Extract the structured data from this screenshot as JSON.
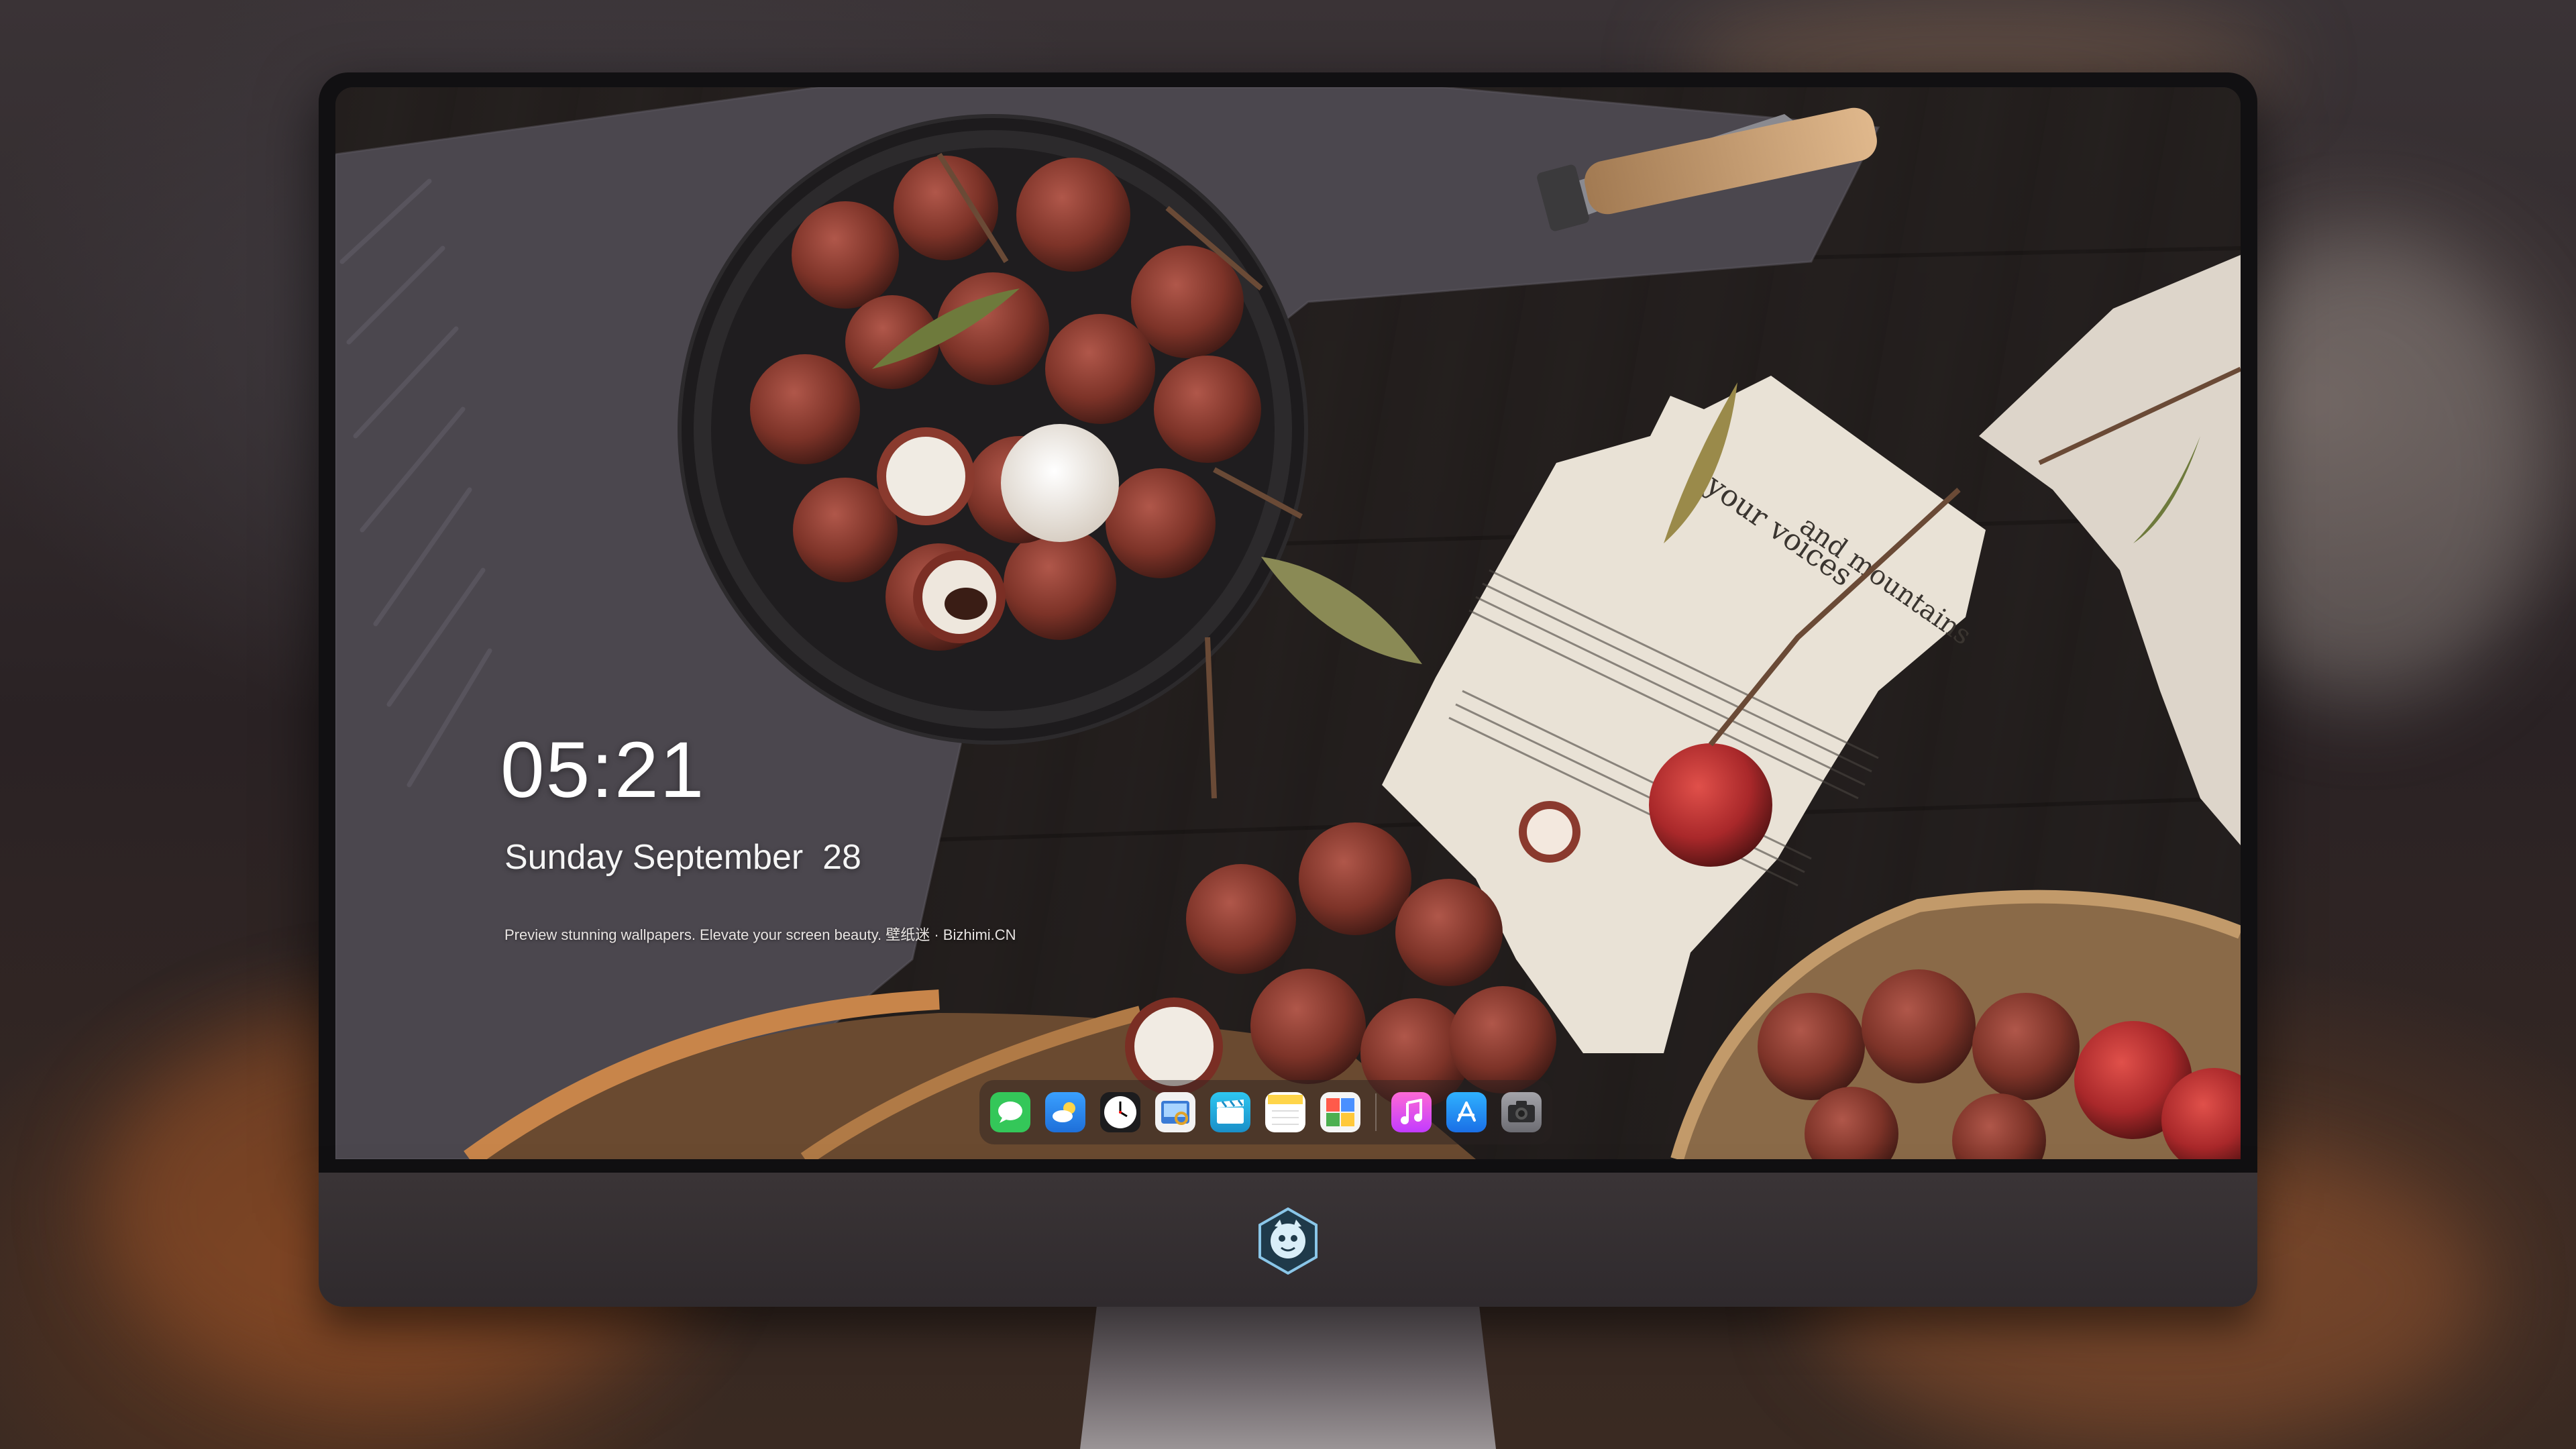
{
  "lockscreen": {
    "time": "05:21",
    "date": "Sunday September  28",
    "tagline": "Preview stunning wallpapers. Elevate your screen beauty. 壁纸迷 · Bizhimi.CN"
  },
  "dock": {
    "apps": [
      {
        "icon": "messages-icon",
        "color": "#34c759"
      },
      {
        "icon": "weather-icon",
        "color": "#1e90ff"
      },
      {
        "icon": "clock-icon",
        "color": "#ffffff"
      },
      {
        "icon": "preview-icon",
        "color": "#3a7bd5"
      },
      {
        "icon": "clips-icon",
        "color": "#27b8e6"
      },
      {
        "icon": "notes-icon",
        "color": "#ffd54a"
      },
      {
        "icon": "photo-booth-icon",
        "color": "#4caf50"
      },
      {
        "icon": "music-icon",
        "color": "#e040fb"
      },
      {
        "icon": "app-store-icon",
        "color": "#1a8cff"
      },
      {
        "icon": "camera-icon",
        "color": "#8e8e93"
      }
    ]
  },
  "colors": {
    "bezel": "#111012",
    "chin": "#3a3436",
    "stand": "#9a9496",
    "text": "#ffffff"
  }
}
